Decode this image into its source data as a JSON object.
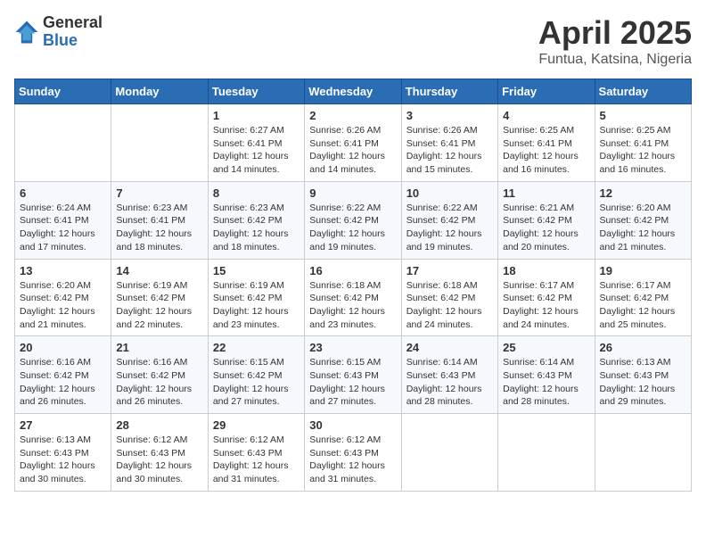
{
  "header": {
    "logo_general": "General",
    "logo_blue": "Blue",
    "title": "April 2025",
    "location": "Funtua, Katsina, Nigeria"
  },
  "weekdays": [
    "Sunday",
    "Monday",
    "Tuesday",
    "Wednesday",
    "Thursday",
    "Friday",
    "Saturday"
  ],
  "weeks": [
    [
      {
        "day": "",
        "sunrise": "",
        "sunset": "",
        "daylight": ""
      },
      {
        "day": "",
        "sunrise": "",
        "sunset": "",
        "daylight": ""
      },
      {
        "day": "1",
        "sunrise": "Sunrise: 6:27 AM",
        "sunset": "Sunset: 6:41 PM",
        "daylight": "Daylight: 12 hours and 14 minutes."
      },
      {
        "day": "2",
        "sunrise": "Sunrise: 6:26 AM",
        "sunset": "Sunset: 6:41 PM",
        "daylight": "Daylight: 12 hours and 14 minutes."
      },
      {
        "day": "3",
        "sunrise": "Sunrise: 6:26 AM",
        "sunset": "Sunset: 6:41 PM",
        "daylight": "Daylight: 12 hours and 15 minutes."
      },
      {
        "day": "4",
        "sunrise": "Sunrise: 6:25 AM",
        "sunset": "Sunset: 6:41 PM",
        "daylight": "Daylight: 12 hours and 16 minutes."
      },
      {
        "day": "5",
        "sunrise": "Sunrise: 6:25 AM",
        "sunset": "Sunset: 6:41 PM",
        "daylight": "Daylight: 12 hours and 16 minutes."
      }
    ],
    [
      {
        "day": "6",
        "sunrise": "Sunrise: 6:24 AM",
        "sunset": "Sunset: 6:41 PM",
        "daylight": "Daylight: 12 hours and 17 minutes."
      },
      {
        "day": "7",
        "sunrise": "Sunrise: 6:23 AM",
        "sunset": "Sunset: 6:41 PM",
        "daylight": "Daylight: 12 hours and 18 minutes."
      },
      {
        "day": "8",
        "sunrise": "Sunrise: 6:23 AM",
        "sunset": "Sunset: 6:42 PM",
        "daylight": "Daylight: 12 hours and 18 minutes."
      },
      {
        "day": "9",
        "sunrise": "Sunrise: 6:22 AM",
        "sunset": "Sunset: 6:42 PM",
        "daylight": "Daylight: 12 hours and 19 minutes."
      },
      {
        "day": "10",
        "sunrise": "Sunrise: 6:22 AM",
        "sunset": "Sunset: 6:42 PM",
        "daylight": "Daylight: 12 hours and 19 minutes."
      },
      {
        "day": "11",
        "sunrise": "Sunrise: 6:21 AM",
        "sunset": "Sunset: 6:42 PM",
        "daylight": "Daylight: 12 hours and 20 minutes."
      },
      {
        "day": "12",
        "sunrise": "Sunrise: 6:20 AM",
        "sunset": "Sunset: 6:42 PM",
        "daylight": "Daylight: 12 hours and 21 minutes."
      }
    ],
    [
      {
        "day": "13",
        "sunrise": "Sunrise: 6:20 AM",
        "sunset": "Sunset: 6:42 PM",
        "daylight": "Daylight: 12 hours and 21 minutes."
      },
      {
        "day": "14",
        "sunrise": "Sunrise: 6:19 AM",
        "sunset": "Sunset: 6:42 PM",
        "daylight": "Daylight: 12 hours and 22 minutes."
      },
      {
        "day": "15",
        "sunrise": "Sunrise: 6:19 AM",
        "sunset": "Sunset: 6:42 PM",
        "daylight": "Daylight: 12 hours and 23 minutes."
      },
      {
        "day": "16",
        "sunrise": "Sunrise: 6:18 AM",
        "sunset": "Sunset: 6:42 PM",
        "daylight": "Daylight: 12 hours and 23 minutes."
      },
      {
        "day": "17",
        "sunrise": "Sunrise: 6:18 AM",
        "sunset": "Sunset: 6:42 PM",
        "daylight": "Daylight: 12 hours and 24 minutes."
      },
      {
        "day": "18",
        "sunrise": "Sunrise: 6:17 AM",
        "sunset": "Sunset: 6:42 PM",
        "daylight": "Daylight: 12 hours and 24 minutes."
      },
      {
        "day": "19",
        "sunrise": "Sunrise: 6:17 AM",
        "sunset": "Sunset: 6:42 PM",
        "daylight": "Daylight: 12 hours and 25 minutes."
      }
    ],
    [
      {
        "day": "20",
        "sunrise": "Sunrise: 6:16 AM",
        "sunset": "Sunset: 6:42 PM",
        "daylight": "Daylight: 12 hours and 26 minutes."
      },
      {
        "day": "21",
        "sunrise": "Sunrise: 6:16 AM",
        "sunset": "Sunset: 6:42 PM",
        "daylight": "Daylight: 12 hours and 26 minutes."
      },
      {
        "day": "22",
        "sunrise": "Sunrise: 6:15 AM",
        "sunset": "Sunset: 6:42 PM",
        "daylight": "Daylight: 12 hours and 27 minutes."
      },
      {
        "day": "23",
        "sunrise": "Sunrise: 6:15 AM",
        "sunset": "Sunset: 6:43 PM",
        "daylight": "Daylight: 12 hours and 27 minutes."
      },
      {
        "day": "24",
        "sunrise": "Sunrise: 6:14 AM",
        "sunset": "Sunset: 6:43 PM",
        "daylight": "Daylight: 12 hours and 28 minutes."
      },
      {
        "day": "25",
        "sunrise": "Sunrise: 6:14 AM",
        "sunset": "Sunset: 6:43 PM",
        "daylight": "Daylight: 12 hours and 28 minutes."
      },
      {
        "day": "26",
        "sunrise": "Sunrise: 6:13 AM",
        "sunset": "Sunset: 6:43 PM",
        "daylight": "Daylight: 12 hours and 29 minutes."
      }
    ],
    [
      {
        "day": "27",
        "sunrise": "Sunrise: 6:13 AM",
        "sunset": "Sunset: 6:43 PM",
        "daylight": "Daylight: 12 hours and 30 minutes."
      },
      {
        "day": "28",
        "sunrise": "Sunrise: 6:12 AM",
        "sunset": "Sunset: 6:43 PM",
        "daylight": "Daylight: 12 hours and 30 minutes."
      },
      {
        "day": "29",
        "sunrise": "Sunrise: 6:12 AM",
        "sunset": "Sunset: 6:43 PM",
        "daylight": "Daylight: 12 hours and 31 minutes."
      },
      {
        "day": "30",
        "sunrise": "Sunrise: 6:12 AM",
        "sunset": "Sunset: 6:43 PM",
        "daylight": "Daylight: 12 hours and 31 minutes."
      },
      {
        "day": "",
        "sunrise": "",
        "sunset": "",
        "daylight": ""
      },
      {
        "day": "",
        "sunrise": "",
        "sunset": "",
        "daylight": ""
      },
      {
        "day": "",
        "sunrise": "",
        "sunset": "",
        "daylight": ""
      }
    ]
  ]
}
